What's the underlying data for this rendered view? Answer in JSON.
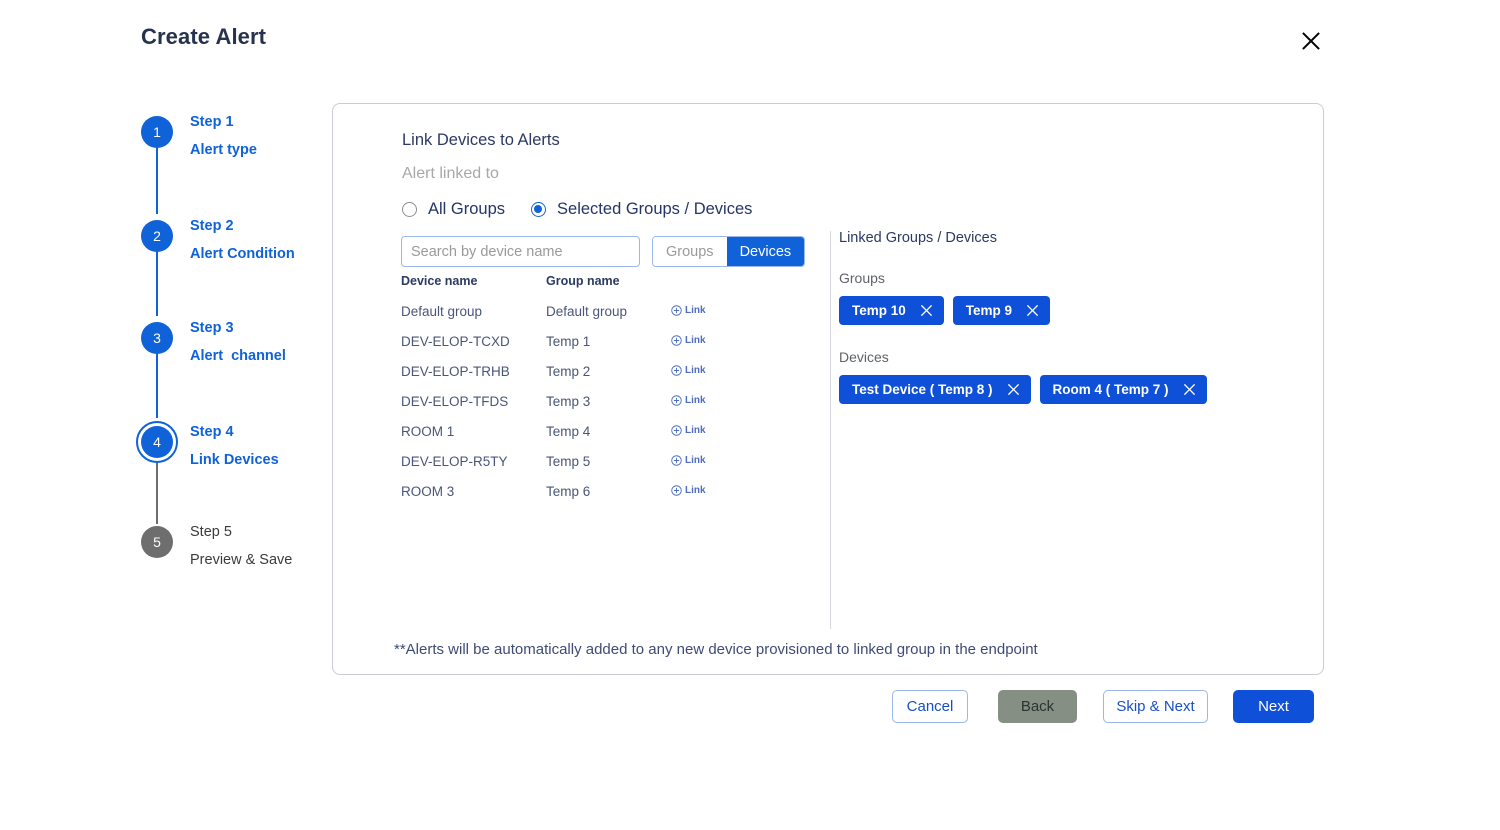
{
  "header": {
    "title": "Create Alert",
    "close_label": "Close"
  },
  "stepper": {
    "steps": [
      {
        "number": "1",
        "name": "Step 1",
        "sub": "Alert type",
        "state": "done"
      },
      {
        "number": "2",
        "name": "Step 2",
        "sub": "Alert Condition",
        "state": "done"
      },
      {
        "number": "3",
        "name": "Step 3",
        "sub": "Alert  channel",
        "state": "done"
      },
      {
        "number": "4",
        "name": "Step 4",
        "sub": "Link Devices",
        "state": "active"
      },
      {
        "number": "5",
        "name": "Step 5",
        "sub": "Preview & Save",
        "state": "inactive"
      }
    ]
  },
  "panel": {
    "title": "Link Devices to Alerts",
    "subtitle": "Alert linked to",
    "radios": [
      {
        "label": "All Groups",
        "selected": false
      },
      {
        "label": "Selected Groups / Devices",
        "selected": true
      }
    ],
    "search": {
      "placeholder": "Search by device name",
      "value": ""
    },
    "toggle": {
      "groups_label": "Groups",
      "devices_label": "Devices",
      "active": "Devices"
    },
    "table": {
      "columns": [
        "Device name",
        "Group name"
      ],
      "link_label": "Link",
      "rows": [
        {
          "device": "Default group",
          "group": "Default group"
        },
        {
          "device": "DEV-ELOP-TCXD",
          "group": "Temp 1"
        },
        {
          "device": "DEV-ELOP-TRHB",
          "group": "Temp 2"
        },
        {
          "device": "DEV-ELOP-TFDS",
          "group": "Temp 3"
        },
        {
          "device": "ROOM 1",
          "group": "Temp 4"
        },
        {
          "device": "DEV-ELOP-R5TY",
          "group": "Temp 5"
        },
        {
          "device": "ROOM 3",
          "group": "Temp 6"
        }
      ]
    },
    "linked": {
      "title": "Linked Groups / Devices",
      "groups_label": "Groups",
      "devices_label": "Devices",
      "groups": [
        "Temp 10",
        "Temp 9"
      ],
      "devices": [
        "Test Device ( Temp 8 )",
        "Room 4 ( Temp 7 )"
      ]
    },
    "footnote": "**Alerts will be automatically added to any new device provisioned to linked group in the endpoint"
  },
  "footer": {
    "cancel": "Cancel",
    "back": "Back",
    "skip_next": "Skip & Next",
    "next": "Next"
  },
  "colors": {
    "primary": "#0f50d8",
    "step_blue": "#0f62d8",
    "step_gray": "#6e6e6e",
    "disabled_btn": "#868f83",
    "text_dark": "#27324e"
  }
}
